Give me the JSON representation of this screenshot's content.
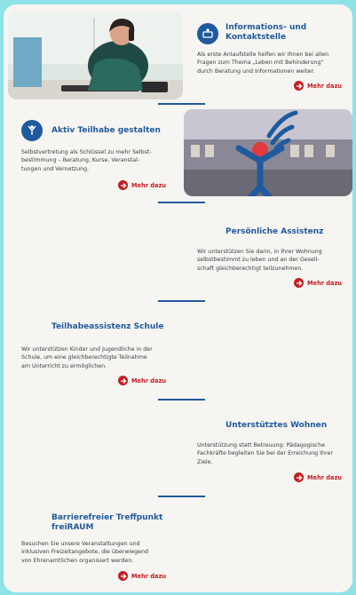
{
  "colors": {
    "accent": "#1f5a9e",
    "link": "#c21e24",
    "background": "#8fe3e6",
    "panel": "#f7f5f1"
  },
  "more_label": "Mehr dazu",
  "sections": [
    {
      "title_line1": "Informations- und",
      "title_line2": "Kontaktstelle",
      "text_lines": [
        "Als erste Anlaufstelle helfen wir Ihnen bei allen",
        "Fragen zum Thema „Leben mit Behinderung“",
        "durch Beratung und Informationen weiter."
      ],
      "icon": "info-desk-icon"
    },
    {
      "title": "Aktiv Teilhabe gestalten",
      "text_lines": [
        "Selbstvertretung als Schlüssel zu mehr Selbst-",
        "bestimmung – Beratung, Kurse, Veranstal-",
        "tungen und Vernetzung."
      ],
      "icon": "person-raising-arms-icon"
    },
    {
      "title": "Persönliche Assistenz",
      "text_lines": [
        "Wir unterstützen Sie darin, in Ihrer Wohnung",
        "selbstbestimmt zu leben und an der Gesell-",
        "schaft gleichberechtigt teilzunehmen."
      ]
    },
    {
      "title": "Teilhabeassistenz Schule",
      "text_lines": [
        "Wir unterstützen Kinder und Jugendliche in der",
        "Schule, um eine gleichberechtigte Teilnahme",
        "am Unterricht zu ermöglichen."
      ]
    },
    {
      "title": "Unterstütztes Wohnen",
      "text_lines": [
        "Unterstützung statt Betreuung: Pädagogische",
        "Fachkräfte begleiten Sie bei der Erreichung Ihrer",
        "Ziele."
      ]
    },
    {
      "title_line1": "Barrierefreier Treffpunkt",
      "title_line2": "freiRAUM",
      "text_lines": [
        "Besuchen Sie unsere Veranstaltungen und",
        "inklusiven Freizeitangebote, die überwiegend",
        "von Ehrenamtlichen organisiert werden."
      ]
    }
  ]
}
